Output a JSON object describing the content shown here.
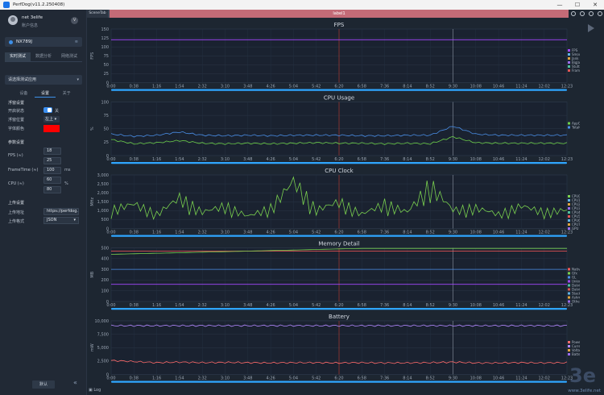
{
  "window": {
    "title": "PerfDog(v11.2.250408)",
    "controls": [
      "—",
      "☐",
      "✕"
    ]
  },
  "sidebar": {
    "username": "net 3elife",
    "user_sub": "账户信息",
    "version_badge": "V",
    "device": "NX789J",
    "mode_tabs": [
      "实时测试",
      "数据分析",
      "网络测试"
    ],
    "app_select": "请选择测试应用",
    "sub_tabs": [
      "设备",
      "设置",
      "关于"
    ],
    "float_title": "浮窗设置",
    "float_enable_label": "开启状态",
    "float_enable_value": "关",
    "float_pos_label": "浮窗位置",
    "float_pos_value": "左上",
    "font_color_label": "字体颜色",
    "params_title": "参数设置",
    "fps_label": "FPS (≈)",
    "fps_values": [
      "18",
      "25"
    ],
    "frametime_label": "FrameTime (≈)",
    "frametime_value": "100",
    "frametime_unit": "ms",
    "cpu_label": "CPU (≈)",
    "cpu_values": [
      "60",
      "80"
    ],
    "cpu_unit": "%",
    "upload_title": "上传设置",
    "upload_url_label": "上传地址",
    "upload_url_value": "https://perfdog.q",
    "upload_fmt_label": "上传格式",
    "upload_fmt_value": "JSON",
    "default_btn": "默认",
    "collapse_icon": "«"
  },
  "labelbar": {
    "left_tag": "SceneTab",
    "label": "label1"
  },
  "log_label": "Log",
  "watermark": "www.3elife.net",
  "time_ticks": [
    "0:00",
    "0:38",
    "1:16",
    "1:54",
    "2:32",
    "3:10",
    "3:48",
    "4:26",
    "5:04",
    "5:42",
    "6:20",
    "6:58",
    "7:36",
    "8:14",
    "8:52",
    "9:30",
    "10:08",
    "10:46",
    "11:24",
    "12:02",
    "12:23"
  ],
  "colors": {
    "accent": "#3d8fe8",
    "label_bar": "#c46b77",
    "red": "#ff0000",
    "purple": "#a448ff",
    "green": "#6dd04a"
  },
  "chart_data": [
    {
      "type": "line",
      "title": "FPS",
      "ylabel": "FPS",
      "ylim": [
        0,
        150
      ],
      "yticks": [
        0,
        25,
        50,
        75,
        100,
        125,
        150
      ],
      "series": [
        {
          "name": "FPS",
          "color": "#a448ff",
          "values": [
            120,
            120,
            120,
            120,
            120,
            120,
            120,
            120,
            120,
            120,
            120,
            120,
            120,
            120,
            120,
            120,
            120,
            120,
            120,
            120,
            120
          ]
        }
      ],
      "legend": [
        "FPS",
        "Smooth(%)",
        "Jank",
        "BigJank",
        "Stutter",
        "FrameTime"
      ]
    },
    {
      "type": "line",
      "title": "CPU Usage",
      "ylabel": "%",
      "ylim": [
        0,
        100
      ],
      "yticks": [
        0,
        25,
        50,
        75,
        100
      ],
      "series": [
        {
          "name": "AppCPU",
          "color": "#6dd04a",
          "values": [
            30,
            22,
            24,
            28,
            23,
            22,
            23,
            22,
            23,
            24,
            23,
            23,
            22,
            23,
            22,
            35,
            24,
            23,
            23,
            23,
            23
          ]
        },
        {
          "name": "TotalCPU",
          "color": "#4a8fe8",
          "values": [
            40,
            36,
            38,
            44,
            38,
            37,
            38,
            37,
            38,
            38,
            38,
            37,
            37,
            38,
            38,
            55,
            40,
            38,
            38,
            38,
            38
          ]
        }
      ],
      "legend": [
        "AppCPU",
        "TotalCPU"
      ]
    },
    {
      "type": "line",
      "title": "CPU Clock",
      "ylabel": "MHz",
      "ylim": [
        0,
        3000
      ],
      "yticks": [
        0,
        500,
        1000,
        1500,
        2000,
        2500,
        3000
      ],
      "series": [
        {
          "name": "CPU Clock",
          "color": "#7ad14f",
          "values": [
            900,
            1200,
            700,
            1500,
            800,
            1100,
            600,
            1000,
            2300,
            900,
            1300,
            700,
            1200,
            800,
            2100,
            900,
            1000,
            700,
            1100,
            800,
            900
          ]
        }
      ],
      "legend": [
        "CPU0",
        "CPU1",
        "CPU2",
        "CPU3",
        "CPU4",
        "CPU5",
        "CPU6",
        "CPU7",
        "GPU"
      ]
    },
    {
      "type": "line",
      "title": "Memory Detail",
      "ylabel": "MB",
      "ylim": [
        0,
        500
      ],
      "yticks": [
        0,
        100,
        200,
        300,
        400,
        500
      ],
      "series": [
        {
          "name": "NativePss",
          "color": "#ff5a5a",
          "values": [
            470,
            470,
            470,
            470,
            470,
            470,
            470,
            470,
            470,
            470,
            470,
            470,
            470,
            470,
            470,
            470,
            470,
            470,
            470,
            470,
            470
          ]
        },
        {
          "name": "Gfx",
          "color": "#7ad14f",
          "values": [
            440,
            445,
            450,
            455,
            460,
            465,
            470,
            475,
            480,
            485,
            490,
            495,
            495,
            495,
            495,
            495,
            495,
            495,
            495,
            495,
            495
          ]
        },
        {
          "name": "GL",
          "color": "#4a8fe8",
          "values": [
            300,
            300,
            300,
            300,
            300,
            300,
            300,
            300,
            300,
            300,
            300,
            300,
            300,
            300,
            300,
            300,
            300,
            300,
            300,
            300,
            300
          ]
        },
        {
          "name": "Java Heap",
          "color": "#a448ff",
          "values": [
            160,
            160,
            160,
            160,
            160,
            160,
            160,
            160,
            160,
            160,
            160,
            160,
            160,
            160,
            160,
            160,
            160,
            160,
            160,
            160,
            160
          ]
        }
      ],
      "legend": [
        "NativePss",
        "Gfx",
        "GL",
        "Unknown",
        "Dalvik Heap",
        "Dalvik Other",
        "Stack",
        "Ashmem",
        "Other dev"
      ]
    },
    {
      "type": "line",
      "title": "Battery",
      "ylabel": "mW",
      "ylim": [
        0,
        10000
      ],
      "yticks": [
        0,
        2500,
        5000,
        7500,
        10000
      ],
      "series": [
        {
          "name": "Power",
          "color": "#ff6b6b",
          "values": [
            2600,
            2400,
            2200,
            2300,
            2200,
            2250,
            2200,
            2150,
            2200,
            2200,
            2150,
            2200,
            2150,
            2150,
            2200,
            2300,
            2150,
            2150,
            2200,
            2150,
            2200
          ]
        },
        {
          "name": "Voltage",
          "color": "#b388ff",
          "values": [
            9100,
            9100,
            9100,
            9100,
            9100,
            9100,
            9100,
            9100,
            9100,
            9100,
            9100,
            9100,
            9100,
            9100,
            9100,
            9100,
            9100,
            9100,
            9100,
            9100,
            9100
          ]
        }
      ],
      "legend": [
        "Power",
        "Current",
        "Voltage",
        "Battery"
      ]
    }
  ]
}
